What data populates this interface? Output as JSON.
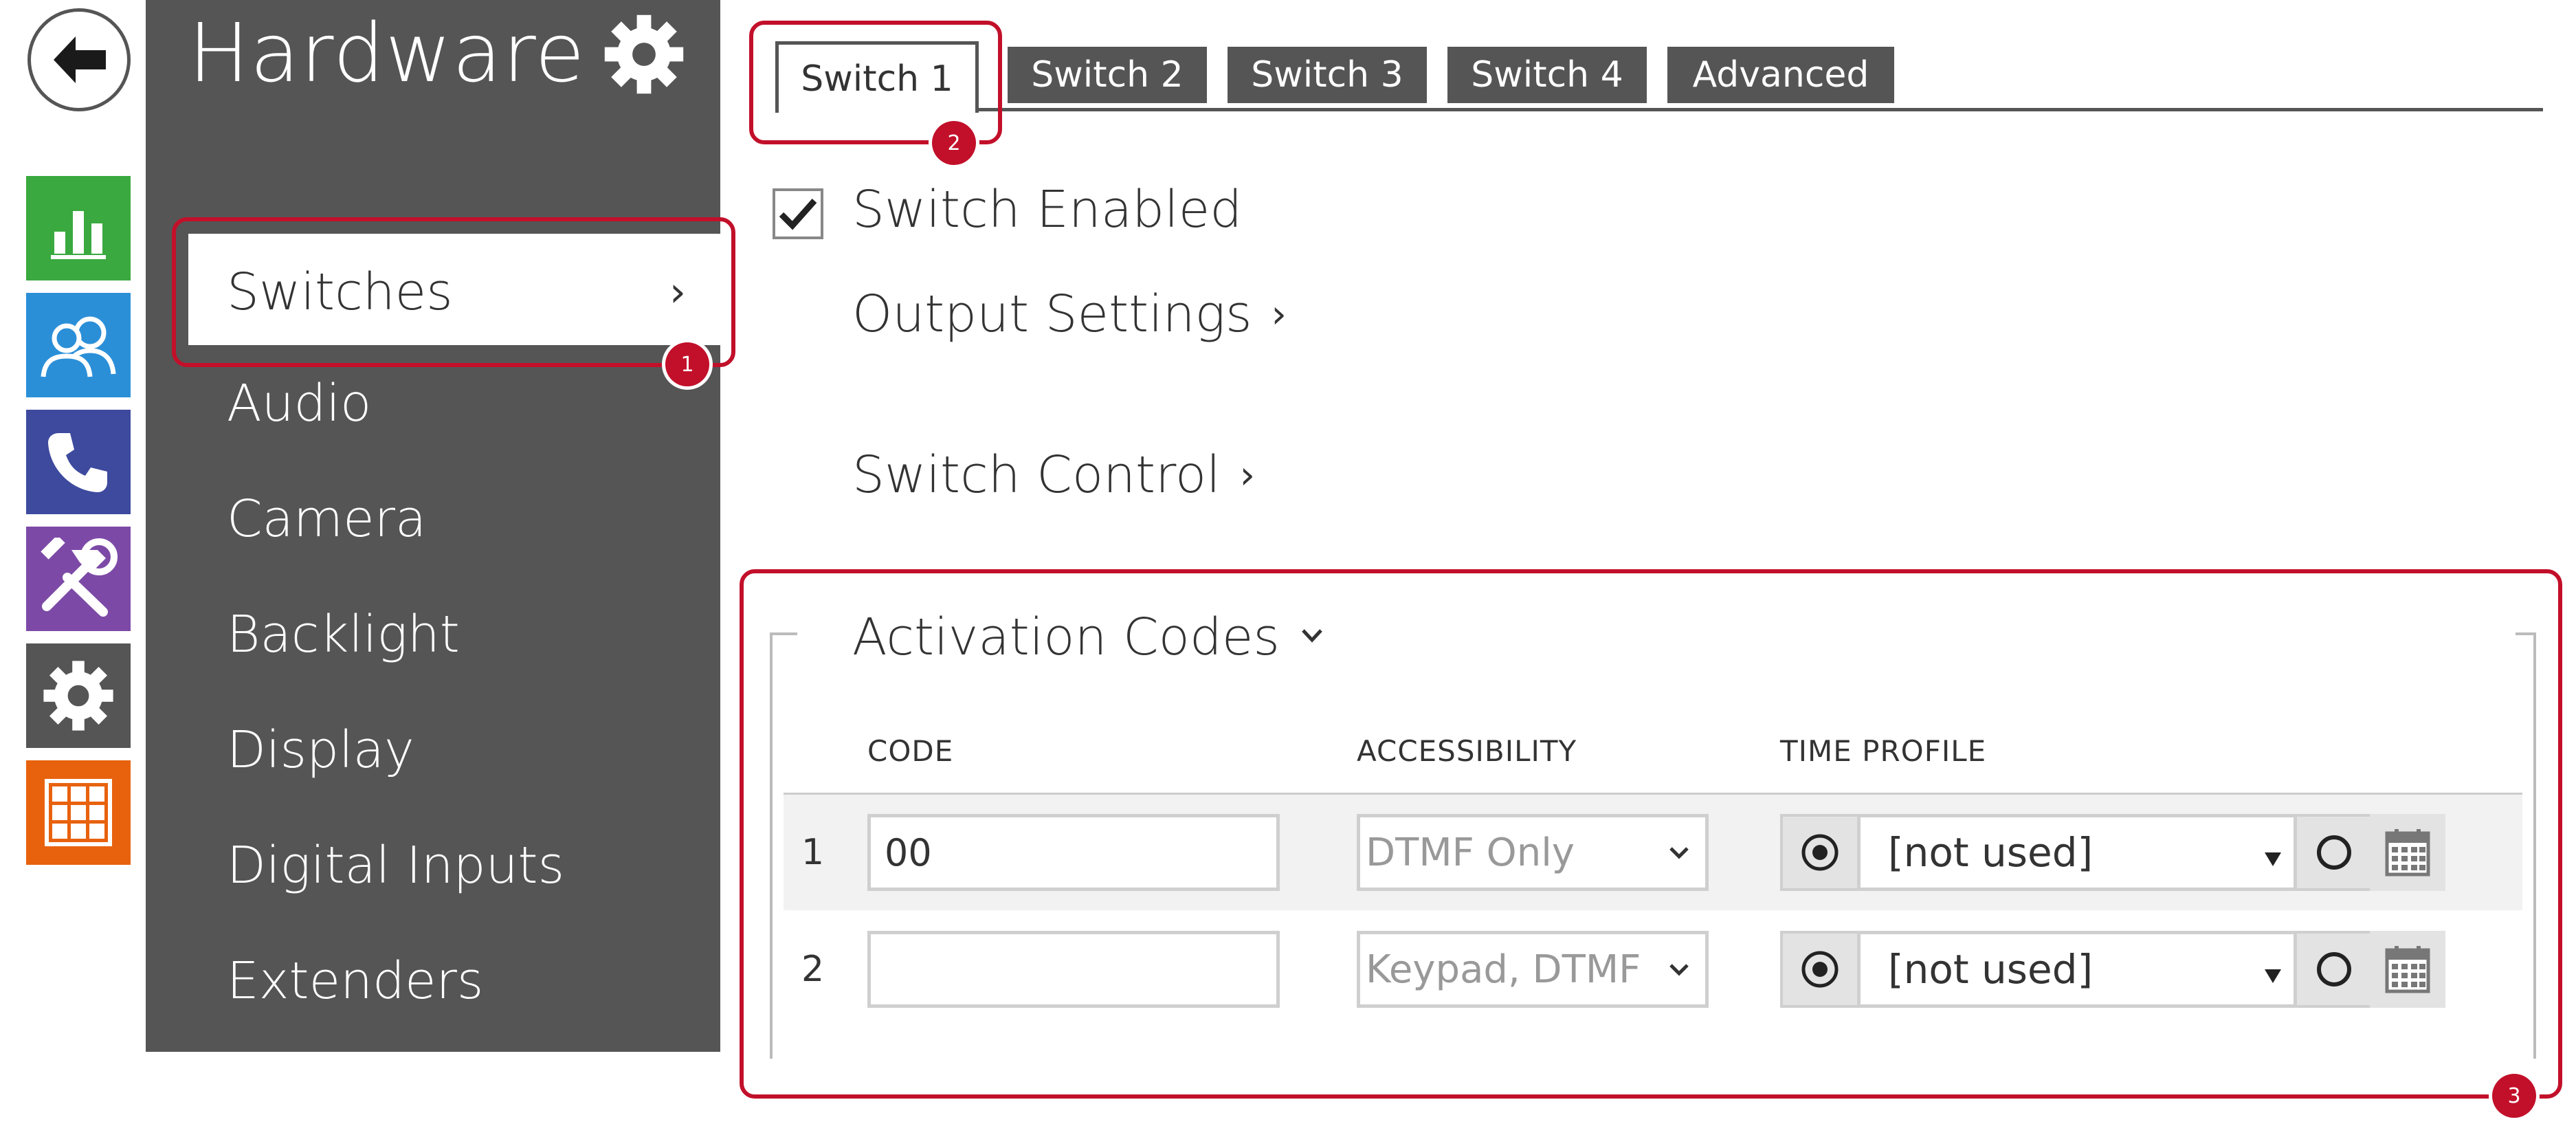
{
  "rail": {
    "back_icon": "back-arrow-icon",
    "tiles": [
      {
        "icon": "status-chart-icon",
        "color": "#3aa93f"
      },
      {
        "icon": "directory-users-icon",
        "color": "#2b8fd8"
      },
      {
        "icon": "phone-icon",
        "color": "#3d4a9e"
      },
      {
        "icon": "hardware-tools-icon",
        "color": "#7c4aa6"
      },
      {
        "icon": "system-gear-icon",
        "color": "#555555"
      },
      {
        "icon": "services-grid-icon",
        "color": "#e8620e"
      }
    ]
  },
  "sidebar": {
    "title": "Hardware",
    "settings_icon": "gear-icon",
    "active_item": "Switches",
    "items": [
      "Audio",
      "Camera",
      "Backlight",
      "Display",
      "Digital Inputs",
      "Extenders"
    ]
  },
  "tabs": {
    "active": "Switch 1",
    "others": [
      "Switch 2",
      "Switch 3",
      "Switch 4",
      "Advanced"
    ]
  },
  "callouts": {
    "one": "1",
    "two": "2",
    "three": "3"
  },
  "switch_enabled": {
    "label": "Switch Enabled",
    "checked": true
  },
  "sections": {
    "output_settings": "Output Settings",
    "switch_control": "Switch Control",
    "activation_codes": "Activation Codes"
  },
  "table": {
    "headers": {
      "code": "CODE",
      "accessibility": "ACCESSIBILITY",
      "time_profile": "TIME PROFILE"
    },
    "rows": [
      {
        "num": "1",
        "code": "00",
        "accessibility": "DTMF Only",
        "time_profile": "[not used]"
      },
      {
        "num": "2",
        "code": "",
        "accessibility": "Keypad, DTMF",
        "time_profile": "[not used]"
      }
    ]
  },
  "colors": {
    "accent_red": "#c2102a",
    "sidebar_bg": "#555555",
    "tab_bg": "#555555"
  }
}
